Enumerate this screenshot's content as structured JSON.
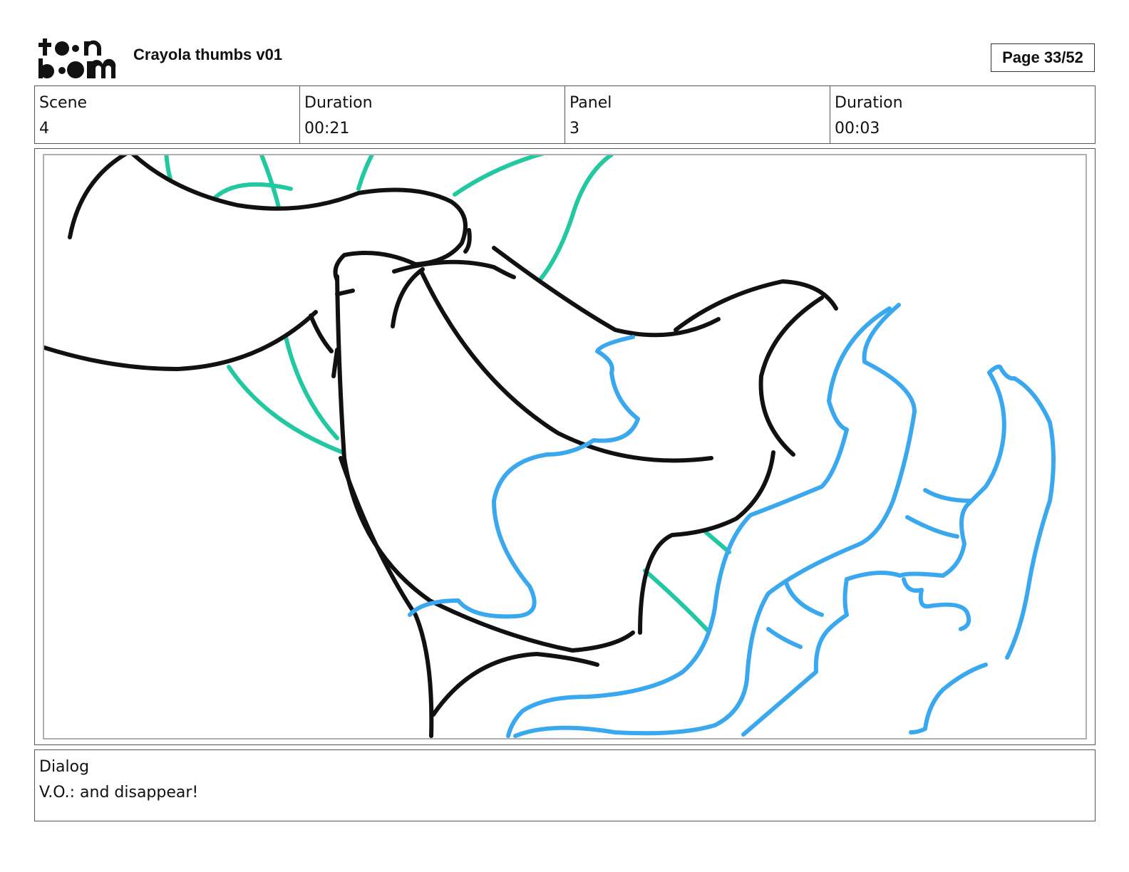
{
  "header": {
    "logo_text": "toonboom",
    "title": "Crayola thumbs v01",
    "page_label": "Page 33/52"
  },
  "info": {
    "scene_label": "Scene",
    "scene_value": "4",
    "scene_duration_label": "Duration",
    "scene_duration_value": "00:21",
    "panel_label": "Panel",
    "panel_value": "3",
    "panel_duration_label": "Duration",
    "panel_duration_value": "00:03"
  },
  "dialog": {
    "label": "Dialog",
    "text": "V.O.: and disappear!"
  },
  "colors": {
    "ink": "#111111",
    "teal": "#22c9a0",
    "blue": "#3aa8ee"
  }
}
